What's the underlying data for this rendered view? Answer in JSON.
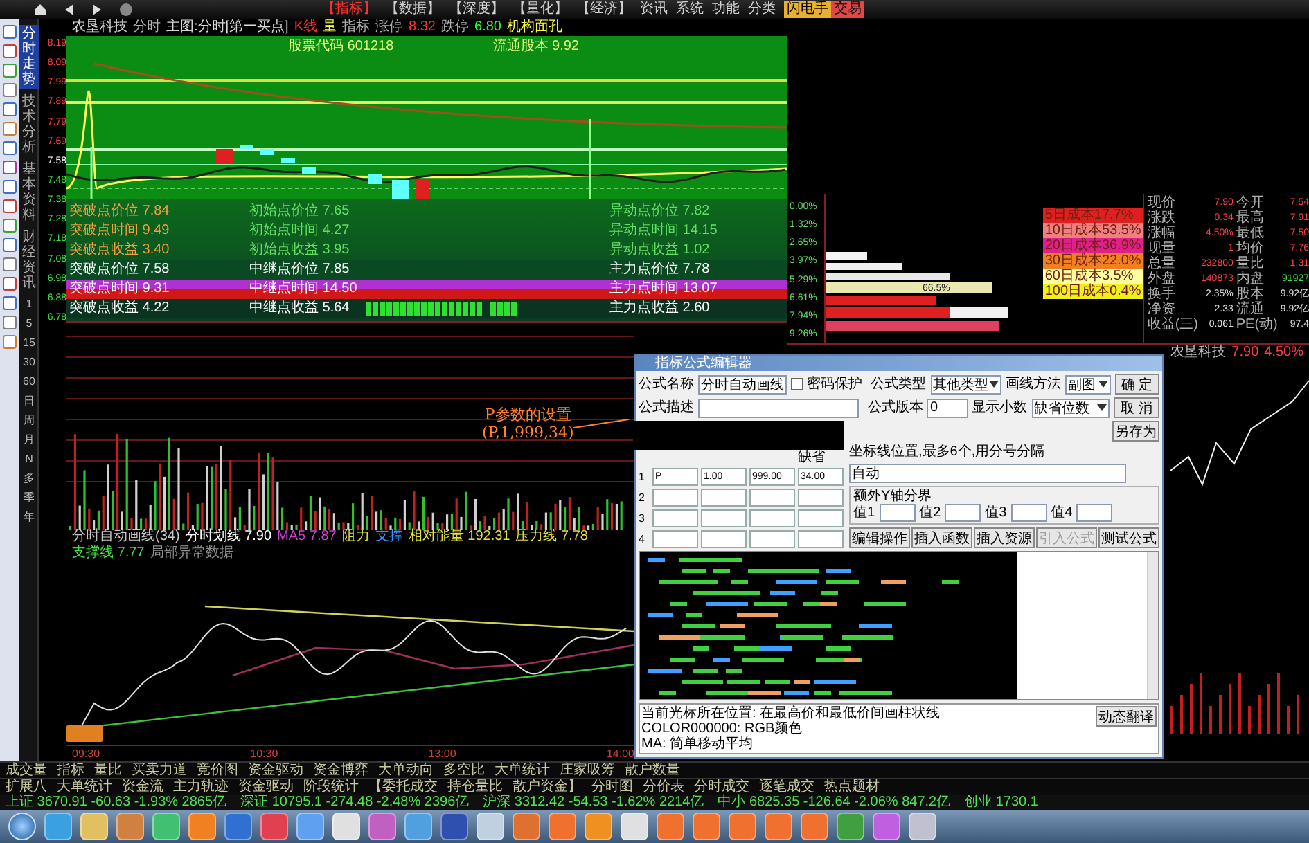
{
  "top_menu": {
    "items": [
      {
        "label": "【指标】",
        "selected": true
      },
      {
        "label": "【数据】",
        "selected": false
      },
      {
        "label": "【深度】",
        "selected": false
      },
      {
        "label": "【量化】",
        "selected": false
      },
      {
        "label": "【经济】",
        "selected": false
      },
      {
        "label": "资讯",
        "selected": false
      },
      {
        "label": "系统",
        "selected": false
      },
      {
        "label": "功能",
        "selected": false
      },
      {
        "label": "分类",
        "selected": false
      }
    ],
    "badges": [
      {
        "label": "闪电手",
        "color": "#e8b030"
      },
      {
        "label": "交易",
        "color": "#e04848"
      }
    ]
  },
  "side_tabs": [
    {
      "label": "分时走势",
      "selected": true
    },
    {
      "label": "技术分析",
      "selected": false
    },
    {
      "label": "基本资料",
      "selected": false
    },
    {
      "label": "财经资讯",
      "selected": false
    }
  ],
  "periods": [
    "1",
    "5",
    "15",
    "30",
    "60",
    "日",
    "周",
    "月",
    "N",
    "多",
    "季",
    "年"
  ],
  "price_axis": [
    "8.19",
    "8.09",
    "7.99",
    "7.89",
    "7.79",
    "7.69",
    "7.58",
    "7.48",
    "7.38",
    "7.28",
    "7.18",
    "7.08",
    "6.98",
    "6.88",
    "6.78"
  ],
  "chart_header": [
    {
      "text": "农垦科技",
      "color": "#d8d8d8"
    },
    {
      "text": "分时",
      "color": "#b0b0b0"
    },
    {
      "text": "主图:分时[第一买点]",
      "color": "#d8d8d8"
    },
    {
      "text": "K线",
      "color": "#ff3030"
    },
    {
      "text": "量",
      "color": "#ffff40"
    },
    {
      "text": "指标",
      "color": "#b0b0b0"
    },
    {
      "text": "涨停",
      "color": "#b0b0b0"
    },
    {
      "text": "8.32",
      "color": "#ff3030"
    },
    {
      "text": "跌停",
      "color": "#b0b0b0"
    },
    {
      "text": "6.80",
      "color": "#30ff30"
    },
    {
      "text": "机构面孔",
      "color": "#ffff40"
    }
  ],
  "green_panel": {
    "code_label": "股票代码 601218",
    "float_label": "流通股本 9.92"
  },
  "signal_rows": [
    {
      "kind": "plain",
      "cells": [
        "突破点价位 7.84",
        "初始点价位 7.65",
        "异动点价位 7.82"
      ]
    },
    {
      "kind": "plain",
      "cells": [
        "突破点时间 9.49",
        "初始点时间 4.27",
        "异动点时间 14.15"
      ]
    },
    {
      "kind": "plain",
      "cells": [
        "突破点收益 3.40",
        "初始点收益 3.95",
        "异动点收益 1.02"
      ]
    },
    {
      "kind": "highlight",
      "cells": [
        "突破点价位 7.58",
        "中继点价位 7.85",
        "主力点价位 7.78"
      ]
    },
    {
      "kind": "band",
      "cells": [
        "突破点时间 9.31",
        "中继点时间 14.50",
        "主力点时间 13.07"
      ]
    },
    {
      "kind": "blocks",
      "cells": [
        "突破点收益 4.22",
        "中继点收益 5.64",
        "主力点收益 2.60"
      ]
    }
  ],
  "percent_axis": [
    "0.00%",
    "1.32%",
    "2.65%",
    "3.97%",
    "5.29%",
    "6.61%",
    "7.94%",
    "9.26%"
  ],
  "annotation": {
    "title": "P参数的设置",
    "detail": "(P,1,999,34)"
  },
  "indicator_header": {
    "items": [
      {
        "text": "分时自动画线(34)",
        "color": "#c8c8c8"
      },
      {
        "text": "分时划线 7.90",
        "color": "#ffffff"
      },
      {
        "text": "MA5 7.87",
        "color": "#d040d0"
      },
      {
        "text": "阻力",
        "color": "#e0e040"
      },
      {
        "text": "支撑",
        "color": "#4090ff"
      },
      {
        "text": "相对能量 192.31",
        "color": "#e0e040"
      },
      {
        "text": "压力线 7.78",
        "color": "#e0e040"
      },
      {
        "text": "支撑线 7.77",
        "color": "#40e040"
      }
    ],
    "note": "局部异常数据"
  },
  "time_axis": [
    "09:30",
    "10:30",
    "13:00",
    "14:00"
  ],
  "cost_bar_label": "66.5%",
  "cost_legend": [
    {
      "label": "5日成本17.7%",
      "color": "#e02020"
    },
    {
      "label": "10日成本53.5%",
      "color": "#f08080"
    },
    {
      "label": "20日成本36.9%",
      "color": "#e0208a"
    },
    {
      "label": "30日成本22.0%",
      "color": "#f08020"
    },
    {
      "label": "60日成本3.5%",
      "color": "#ffffa0"
    },
    {
      "label": "100日成本0.4%",
      "color": "#f0f020"
    }
  ],
  "quote_table": [
    [
      "现价",
      "7.90",
      "今开",
      "7.54"
    ],
    [
      "涨跌",
      "0.34",
      "最高",
      "7.91"
    ],
    [
      "涨幅",
      "4.50%",
      "最低",
      "7.50"
    ],
    [
      "现量",
      "1",
      "均价",
      "7.76"
    ],
    [
      "总量",
      "232800",
      "量比",
      "1.31"
    ],
    [
      "外盘",
      "140873",
      "内盘",
      "91927"
    ],
    [
      "换手",
      "2.35%",
      "股本",
      "9.92亿"
    ],
    [
      "净资",
      "2.33",
      "流通",
      "9.92亿"
    ],
    [
      "收益(三)",
      "0.061",
      "PE(动)",
      "97.4"
    ]
  ],
  "ticker": {
    "name": "农垦科技",
    "price": "7.90",
    "change": "4.50%"
  },
  "dialog": {
    "title": "指标公式编辑器",
    "name_label": "公式名称",
    "name_value": "分时自动画线",
    "password": {
      "label": "密码保护",
      "checked": false
    },
    "desc_label": "公式描述",
    "type_label": "公式类型",
    "type_value": "其他类型",
    "draw_label": "画线方法",
    "draw_value": "副图",
    "version_label": "公式版本",
    "version_value": "0",
    "decimals_label": "显示小数",
    "decimals_value": "缺省位数",
    "side_buttons": [
      "确 定",
      "取 消",
      "另存为"
    ],
    "param_header": "缺省",
    "params": [
      {
        "index": "1",
        "cells": [
          "P",
          "1.00",
          "999.00",
          "34.00"
        ]
      },
      {
        "index": "2"
      },
      {
        "index": "3"
      },
      {
        "index": "4"
      }
    ],
    "axis_label": "坐标线位置,最多6个,用分号分隔",
    "axis_value": "自动",
    "yaxis_group": "额外Y轴分界",
    "yaxis_values": [
      "值1",
      "值2",
      "值3",
      "值4"
    ],
    "buttons": [
      {
        "label": "编辑操作",
        "disabled": false
      },
      {
        "label": "插入函数",
        "disabled": false
      },
      {
        "label": "插入资源",
        "disabled": false
      },
      {
        "label": "引入公式",
        "disabled": true
      },
      {
        "label": "测试公式",
        "disabled": false
      }
    ],
    "messages": [
      "当前光标所在位置: 在最高价和最低价间画柱状线",
      "COLOR000000: RGB颜色",
      "MA: 简单移动平均"
    ],
    "translate_button": "动态翻译"
  },
  "bottom_tabs": [
    [
      "成交量",
      "指标",
      "量比",
      "买卖力道",
      "竞价图",
      "资金驱动",
      "资金博弈",
      "大单动向",
      "多空比",
      "大单统计",
      "庄家吸筹",
      "散户数量"
    ],
    [
      "扩展八",
      "大单统计",
      "资金流",
      "主力轨迹",
      "资金驱动",
      "阶段统计",
      "【委托成交",
      "持仓量比",
      "散户资金】",
      "分时图",
      "分价表",
      "分时成交",
      "逐笔成交",
      "热点题材"
    ]
  ],
  "status_bar": [
    "上证 3670.91 -60.63 -1.93% 2865亿",
    "深证 10795.1 -274.48 -2.48% 2396亿",
    "沪深 3312.42 -54.53 -1.62% 2214亿",
    "中小 6825.35 -126.64 -2.06% 847.2亿",
    "创业 1730.1"
  ]
}
